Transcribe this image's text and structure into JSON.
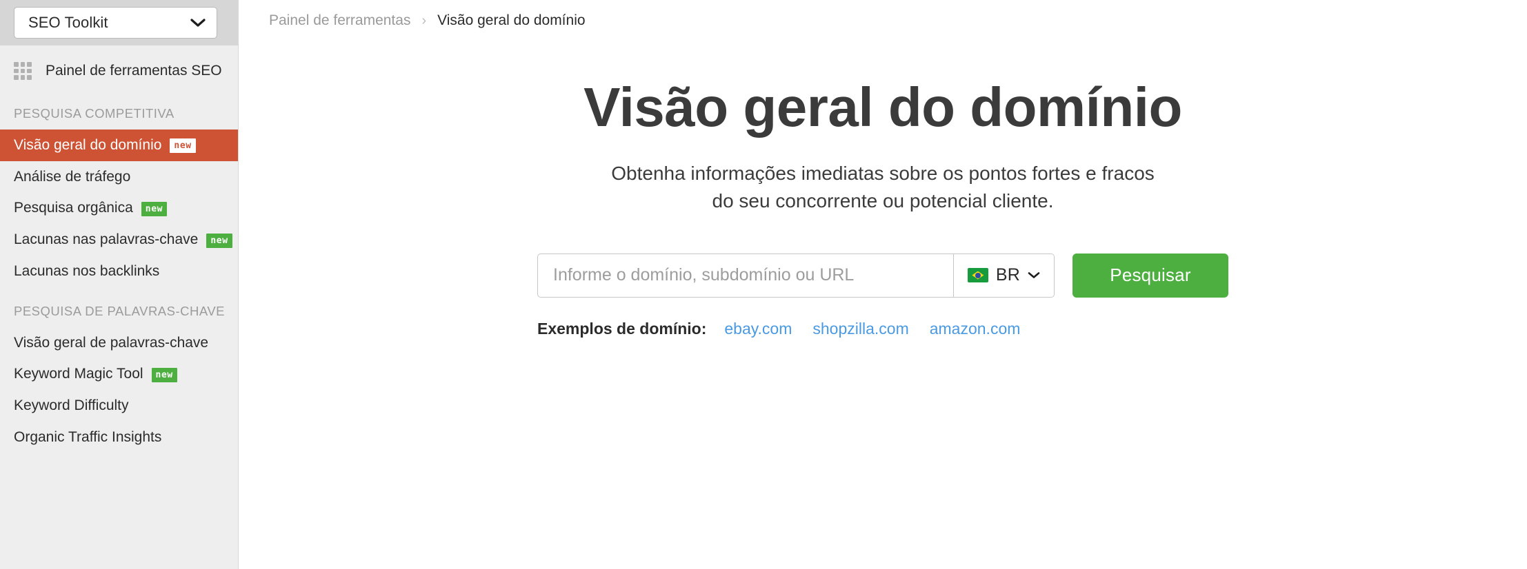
{
  "sidebar": {
    "toolkit_selector": {
      "label": "SEO Toolkit",
      "icon": "chevron-down-icon"
    },
    "dashboard": {
      "label": "Painel de ferramentas SEO",
      "icon": "grid-icon"
    },
    "sections": [
      {
        "title": "PESQUISA COMPETITIVA",
        "items": [
          {
            "label": "Visão geral do domínio",
            "badge": "new",
            "active": true
          },
          {
            "label": "Análise de tráfego",
            "badge": "",
            "active": false
          },
          {
            "label": "Pesquisa orgânica",
            "badge": "new",
            "active": false
          },
          {
            "label": "Lacunas nas palavras-chave",
            "badge": "new",
            "active": false
          },
          {
            "label": "Lacunas nos backlinks",
            "badge": "",
            "active": false
          }
        ]
      },
      {
        "title": "PESQUISA DE PALAVRAS-CHAVE",
        "items": [
          {
            "label": "Visão geral de palavras-chave",
            "badge": "",
            "active": false
          },
          {
            "label": "Keyword Magic Tool",
            "badge": "new",
            "active": false
          },
          {
            "label": "Keyword Difficulty",
            "badge": "",
            "active": false
          },
          {
            "label": "Organic Traffic Insights",
            "badge": "",
            "active": false
          }
        ]
      }
    ]
  },
  "breadcrumb": {
    "parent": "Painel de ferramentas",
    "separator": "›",
    "current": "Visão geral do domínio"
  },
  "hero": {
    "title": "Visão geral do domínio",
    "subtitle_line1": "Obtenha informações imediatas sobre os pontos fortes e fracos",
    "subtitle_line2": "do seu concorrente ou potencial cliente."
  },
  "search": {
    "placeholder": "Informe o domínio, subdomínio ou URL",
    "value": "",
    "country_code": "BR",
    "country_flag": "brazil-flag-icon",
    "country_chevron": "chevron-down-icon",
    "button_label": "Pesquisar"
  },
  "examples": {
    "label": "Exemplos de domínio:",
    "links": [
      "ebay.com",
      "shopzilla.com",
      "amazon.com"
    ]
  },
  "colors": {
    "active_nav": "#cd5334",
    "badge_green": "#4caf3f",
    "button_green": "#4caf3f",
    "link_blue": "#4a9ae3",
    "sidebar_bg": "#eeeeee",
    "sidebar_top_bg": "#d6d6d6"
  }
}
